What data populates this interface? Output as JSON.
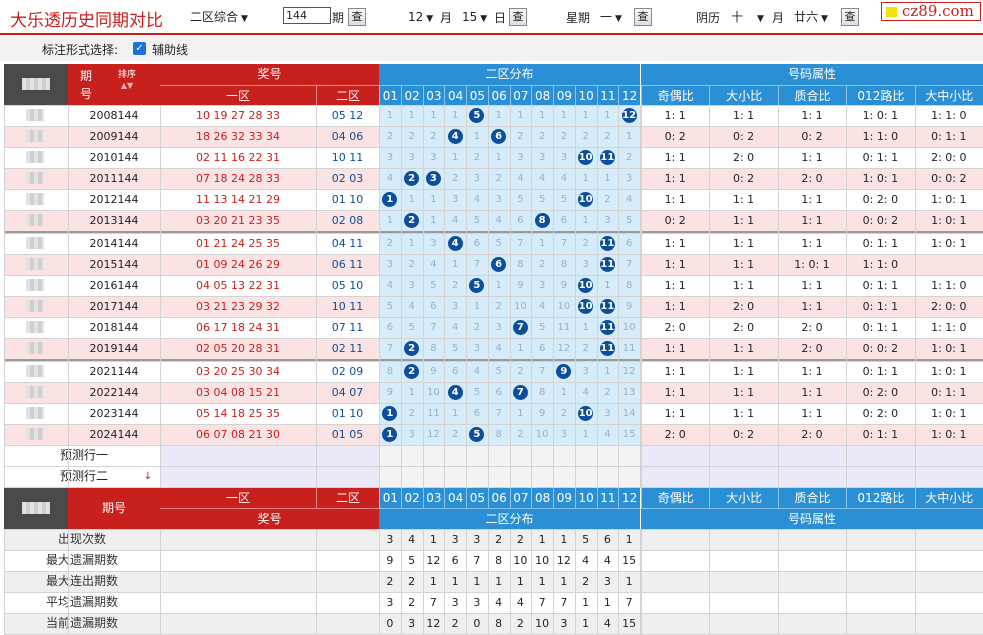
{
  "title": "大乐透历史同期对比",
  "controls": {
    "zone_select": "二区综合",
    "issue_value": "144",
    "issue_unit": "期",
    "query": "查",
    "month": "12",
    "month_unit": "月",
    "day": "15",
    "day_unit": "日",
    "week_label": "星期",
    "week_val": "一",
    "lunar_label": "阴历",
    "lunar_month": "十",
    "lunar_month_unit": "月",
    "lunar_day": "廿六",
    "logo": "cz89.com"
  },
  "mark": {
    "label": "标注形式选择:",
    "check": "✓",
    "aux": "辅助线"
  },
  "header": {
    "issue": "期",
    "issue2": "号",
    "sort": "排序",
    "prize": "奖号",
    "zone1": "一区",
    "zone2": "二区",
    "dist": "二区分布",
    "attr": "号码属性",
    "nums": [
      "01",
      "02",
      "03",
      "04",
      "05",
      "06",
      "07",
      "08",
      "09",
      "10",
      "11",
      "12"
    ],
    "attrs": [
      "奇偶比",
      "大小比",
      "质合比",
      "012路比",
      "大中小比"
    ]
  },
  "rows": [
    {
      "issue": "2008144",
      "z1": "10 19 27 28 33",
      "z2": "05 12",
      "dist": [
        "1",
        "1",
        "1",
        "1",
        "5",
        "1",
        "1",
        "1",
        "1",
        "1",
        "1",
        "12"
      ],
      "attr": [
        "1: 1",
        "1: 1",
        "1: 1",
        "1: 0: 1",
        "1: 1: 0"
      ]
    },
    {
      "issue": "2009144",
      "z1": "18 26 32 33 34",
      "z2": "04 06",
      "dist": [
        "2",
        "2",
        "2",
        "4",
        "1",
        "6",
        "2",
        "2",
        "2",
        "2",
        "2",
        "1"
      ],
      "attr": [
        "0: 2",
        "0: 2",
        "0: 2",
        "1: 1: 0",
        "0: 1: 1"
      ]
    },
    {
      "issue": "2010144",
      "z1": "02 11 16 22 31",
      "z2": "10 11",
      "dist": [
        "3",
        "3",
        "3",
        "1",
        "2",
        "1",
        "3",
        "3",
        "3",
        "10",
        "11",
        "2"
      ],
      "attr": [
        "1: 1",
        "2: 0",
        "1: 1",
        "0: 1: 1",
        "2: 0: 0"
      ]
    },
    {
      "issue": "2011144",
      "z1": "07 18 24 28 33",
      "z2": "02 03",
      "dist": [
        "4",
        "2",
        "3",
        "2",
        "3",
        "2",
        "4",
        "4",
        "4",
        "1",
        "1",
        "3"
      ],
      "attr": [
        "1: 1",
        "0: 2",
        "2: 0",
        "1: 0: 1",
        "0: 0: 2"
      ]
    },
    {
      "issue": "2012144",
      "z1": "11 13 14 21 29",
      "z2": "01 10",
      "dist": [
        "1",
        "1",
        "1",
        "3",
        "4",
        "3",
        "5",
        "5",
        "5",
        "10",
        "2",
        "4"
      ],
      "attr": [
        "1: 1",
        "1: 1",
        "1: 1",
        "0: 2: 0",
        "1: 0: 1"
      ]
    },
    {
      "issue": "2013144",
      "z1": "03 20 21 23 35",
      "z2": "02 08",
      "dist": [
        "1",
        "2",
        "1",
        "4",
        "5",
        "4",
        "6",
        "8",
        "6",
        "1",
        "3",
        "5"
      ],
      "attr": [
        "0: 2",
        "1: 1",
        "1: 1",
        "0: 0: 2",
        "1: 0: 1"
      ]
    },
    {
      "issue": "2014144",
      "z1": "01 21 24 25 35",
      "z2": "04 11",
      "dist": [
        "2",
        "1",
        "3",
        "4",
        "6",
        "5",
        "7",
        "1",
        "7",
        "2",
        "11",
        "6"
      ],
      "attr": [
        "1: 1",
        "1: 1",
        "1: 1",
        "0: 1: 1",
        "1: 0: 1"
      ]
    },
    {
      "issue": "2015144",
      "z1": "01 09 24 26 29",
      "z2": "06 11",
      "dist": [
        "3",
        "2",
        "4",
        "1",
        "7",
        "6",
        "8",
        "2",
        "8",
        "3",
        "11",
        "7"
      ],
      "attr": [
        "1: 1",
        "1: 1",
        "1: 0: 1",
        "1: 1: 0",
        ""
      ]
    },
    {
      "issue": "2016144",
      "z1": "04 05 13 22 31",
      "z2": "05 10",
      "dist": [
        "4",
        "3",
        "5",
        "2",
        "5",
        "1",
        "9",
        "3",
        "9",
        "10",
        "1",
        "8"
      ],
      "attr": [
        "1: 1",
        "1: 1",
        "1: 1",
        "0: 1: 1",
        "1: 1: 0"
      ]
    },
    {
      "issue": "2017144",
      "z1": "03 21 23 29 32",
      "z2": "10 11",
      "dist": [
        "5",
        "4",
        "6",
        "3",
        "1",
        "2",
        "10",
        "4",
        "10",
        "10",
        "11",
        "9"
      ],
      "attr": [
        "1: 1",
        "2: 0",
        "1: 1",
        "0: 1: 1",
        "2: 0: 0"
      ]
    },
    {
      "issue": "2018144",
      "z1": "06 17 18 24 31",
      "z2": "07 11",
      "dist": [
        "6",
        "5",
        "7",
        "4",
        "2",
        "3",
        "7",
        "5",
        "11",
        "1",
        "11",
        "10"
      ],
      "attr": [
        "2: 0",
        "2: 0",
        "2: 0",
        "0: 1: 1",
        "1: 1: 0"
      ]
    },
    {
      "issue": "2019144",
      "z1": "02 05 20 28 31",
      "z2": "02 11",
      "dist": [
        "7",
        "2",
        "8",
        "5",
        "3",
        "4",
        "1",
        "6",
        "12",
        "2",
        "11",
        "11"
      ],
      "attr": [
        "1: 1",
        "1: 1",
        "2: 0",
        "0: 0: 2",
        "1: 0: 1"
      ]
    },
    {
      "issue": "2021144",
      "z1": "03 20 25 30 34",
      "z2": "02 09",
      "dist": [
        "8",
        "2",
        "9",
        "6",
        "4",
        "5",
        "2",
        "7",
        "9",
        "3",
        "1",
        "12"
      ],
      "attr": [
        "1: 1",
        "1: 1",
        "1: 1",
        "0: 1: 1",
        "1: 0: 1"
      ]
    },
    {
      "issue": "2022144",
      "z1": "03 04 08 15 21",
      "z2": "04 07",
      "dist": [
        "9",
        "1",
        "10",
        "4",
        "5",
        "6",
        "7",
        "8",
        "1",
        "4",
        "2",
        "13"
      ],
      "attr": [
        "1: 1",
        "1: 1",
        "1: 1",
        "0: 2: 0",
        "0: 1: 1"
      ]
    },
    {
      "issue": "2023144",
      "z1": "05 14 18 25 35",
      "z2": "01 10",
      "dist": [
        "1",
        "2",
        "11",
        "1",
        "6",
        "7",
        "1",
        "9",
        "2",
        "10",
        "3",
        "14"
      ],
      "attr": [
        "1: 1",
        "1: 1",
        "1: 1",
        "0: 2: 0",
        "1: 0: 1"
      ]
    },
    {
      "issue": "2024144",
      "z1": "06 07 08 21 30",
      "z2": "01 05",
      "dist": [
        "1",
        "3",
        "12",
        "2",
        "5",
        "8",
        "2",
        "10",
        "3",
        "1",
        "4",
        "15"
      ],
      "attr": [
        "2: 0",
        "0: 2",
        "2: 0",
        "0: 1: 1",
        "1: 0: 1"
      ]
    }
  ],
  "hits": [
    [
      5,
      12
    ],
    [
      4,
      6
    ],
    [
      10,
      11
    ],
    [
      2,
      3
    ],
    [
      1,
      10
    ],
    [
      2,
      8
    ],
    [
      4,
      11
    ],
    [
      6,
      11
    ],
    [
      5,
      10
    ],
    [
      10,
      11
    ],
    [
      7,
      11
    ],
    [
      2,
      11
    ],
    [
      2,
      9
    ],
    [
      4,
      7
    ],
    [
      1,
      10
    ],
    [
      1,
      5
    ]
  ],
  "predict": [
    "预测行一",
    "预测行二"
  ],
  "predict_arrow": "↓",
  "footer_header": {
    "issue": "期号",
    "zone1": "一区",
    "zone2": "二区",
    "prize": "奖号",
    "dist": "二区分布",
    "attr": "号码属性"
  },
  "stats": [
    {
      "label": "出现次数",
      "values": [
        "3",
        "4",
        "1",
        "3",
        "3",
        "2",
        "2",
        "1",
        "1",
        "5",
        "6",
        "1"
      ]
    },
    {
      "label": "最大遗漏期数",
      "values": [
        "9",
        "5",
        "12",
        "6",
        "7",
        "8",
        "10",
        "10",
        "12",
        "4",
        "4",
        "15"
      ]
    },
    {
      "label": "最大连出期数",
      "values": [
        "2",
        "2",
        "1",
        "1",
        "1",
        "1",
        "1",
        "1",
        "1",
        "2",
        "3",
        "1"
      ]
    },
    {
      "label": "平均遗漏期数",
      "values": [
        "3",
        "2",
        "7",
        "3",
        "3",
        "4",
        "4",
        "7",
        "7",
        "1",
        "1",
        "7"
      ]
    },
    {
      "label": "当前遗漏期数",
      "values": [
        "0",
        "3",
        "12",
        "2",
        "0",
        "8",
        "2",
        "10",
        "3",
        "1",
        "4",
        "15"
      ]
    }
  ],
  "colors": {
    "red": "#c8201d",
    "blue": "#0b4f9c",
    "teal": "#2b8fd6",
    "rowa": "#fbe3e3",
    "rowb": "#ffffff",
    "distbg": "#d6ecfb",
    "predictbg": "#e9e9f7"
  }
}
